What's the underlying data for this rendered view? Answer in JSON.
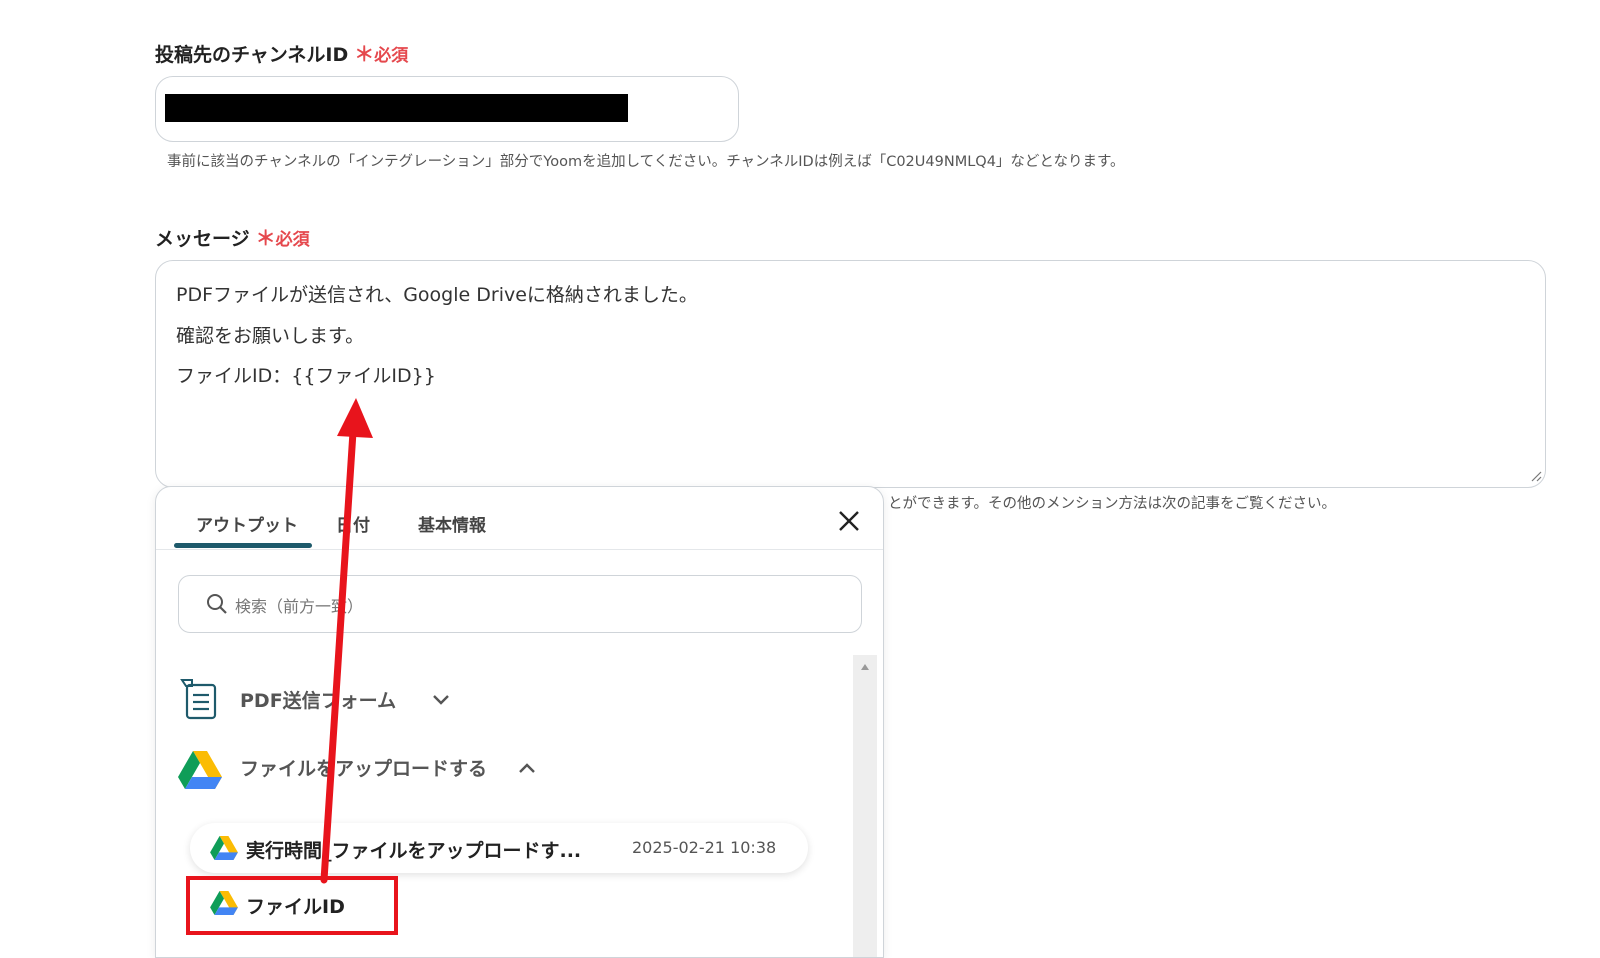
{
  "channel_field": {
    "label": "投稿先のチャンネルID",
    "required_mark": "＊",
    "required_text": "必須",
    "help": "事前に該当のチャンネルの「インテグレーション」部分でYoomを追加してください。チャンネルIDは例えば「C02U49NMLQ4」などとなります。"
  },
  "message_field": {
    "label": "メッセージ",
    "required_mark": "＊",
    "required_text": "必須",
    "lines": [
      "PDFファイルが送信され、Google Driveに格納されました。",
      "確認をお願いします。",
      "ファイルID：{{ファイルID}}"
    ],
    "help_partial": "とができます。その他のメンション方法は次の記事をご覧ください。"
  },
  "panel": {
    "tabs": [
      {
        "label": "アウトプット",
        "active": true
      },
      {
        "label": "日付",
        "active": false
      },
      {
        "label": "基本情報",
        "active": false
      }
    ],
    "search_placeholder": "検索（前方一致）",
    "groups": [
      {
        "title": "PDF送信フォーム",
        "icon": "form-icon",
        "expanded": false
      },
      {
        "title": "ファイルをアップロードする",
        "icon": "google-drive-icon",
        "expanded": true
      }
    ],
    "items": [
      {
        "title": "実行時間_ファイルをアップロードす...",
        "time": "2025-02-21 10:38",
        "icon": "google-drive-icon"
      },
      {
        "title": "ファイルID",
        "icon": "google-drive-icon"
      }
    ]
  },
  "colors": {
    "required": "#e5484d",
    "tab_active": "#1e5a6b",
    "annotation": "#e8141c"
  }
}
